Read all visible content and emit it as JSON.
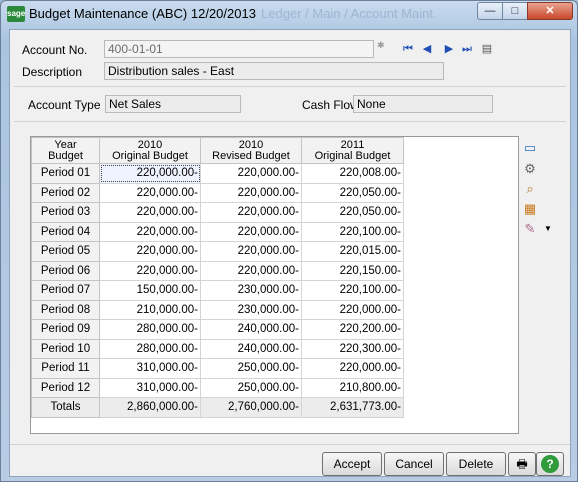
{
  "window": {
    "app_icon_text": "sage",
    "title": "Budget Maintenance (ABC) 12/20/2013",
    "ghost_title": "Ledger / Main / Account Maint.",
    "controls": {
      "minimize": "—",
      "maximize": "□",
      "close": "✕"
    }
  },
  "header": {
    "account_no_label": "Account No.",
    "account_no_value": "400-01-01",
    "description_label": "Description",
    "description_value": "Distribution sales - East",
    "account_type_label": "Account Type",
    "account_type_value": "Net Sales",
    "cash_flow_label": "Cash Flow",
    "cash_flow_value": "None",
    "nav_icons": [
      "first-record-icon",
      "previous-record-icon",
      "next-record-icon",
      "last-record-icon",
      "lookup-list-icon"
    ]
  },
  "grid": {
    "columns": [
      {
        "line1": "Year",
        "line2": "Budget"
      },
      {
        "line1": "2010",
        "line2": "Original Budget"
      },
      {
        "line1": "2010",
        "line2": "Revised Budget"
      },
      {
        "line1": "2011",
        "line2": "Original Budget"
      }
    ],
    "rows": [
      {
        "label": "Period 01",
        "values": [
          "220,000.00-",
          "220,000.00-",
          "220,008.00-"
        ]
      },
      {
        "label": "Period 02",
        "values": [
          "220,000.00-",
          "220,000.00-",
          "220,050.00-"
        ]
      },
      {
        "label": "Period 03",
        "values": [
          "220,000.00-",
          "220,000.00-",
          "220,050.00-"
        ]
      },
      {
        "label": "Period 04",
        "values": [
          "220,000.00-",
          "220,000.00-",
          "220,100.00-"
        ]
      },
      {
        "label": "Period 05",
        "values": [
          "220,000.00-",
          "220,000.00-",
          "220,015.00-"
        ]
      },
      {
        "label": "Period 06",
        "values": [
          "220,000.00-",
          "220,000.00-",
          "220,150.00-"
        ]
      },
      {
        "label": "Period 07",
        "values": [
          "150,000.00-",
          "230,000.00-",
          "220,100.00-"
        ]
      },
      {
        "label": "Period 08",
        "values": [
          "210,000.00-",
          "230,000.00-",
          "220,000.00-"
        ]
      },
      {
        "label": "Period 09",
        "values": [
          "280,000.00-",
          "240,000.00-",
          "220,200.00-"
        ]
      },
      {
        "label": "Period 10",
        "values": [
          "280,000.00-",
          "240,000.00-",
          "220,300.00-"
        ]
      },
      {
        "label": "Period 11",
        "values": [
          "310,000.00-",
          "250,000.00-",
          "220,000.00-"
        ]
      },
      {
        "label": "Period 12",
        "values": [
          "310,000.00-",
          "250,000.00-",
          "210,800.00-"
        ]
      }
    ],
    "totals": {
      "label": "Totals",
      "values": [
        "2,860,000.00-",
        "2,760,000.00-",
        "2,631,773.00-"
      ]
    },
    "side_icons": [
      "window-icon",
      "gear-icon",
      "zoom-icon",
      "spreadsheet-icon",
      "edit-list-icon"
    ]
  },
  "footer": {
    "accept_label": "Accept",
    "cancel_label": "Cancel",
    "delete_label": "Delete",
    "help_label": "?"
  }
}
